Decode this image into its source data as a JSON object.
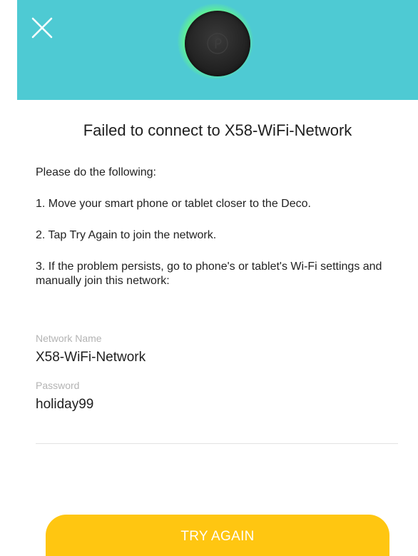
{
  "header": {
    "background_color": "#4ecad3",
    "close_icon": "close-icon",
    "device_icon": "deco-device-icon"
  },
  "title": "Failed to connect to X58-WiFi-Network",
  "instructions": {
    "intro": "Please do the following:",
    "steps": [
      "1. Move your smart phone or tablet closer to the Deco.",
      "2. Tap Try Again to join the network.",
      "3. If the problem persists, go to phone's or tablet's Wi-Fi settings and manually join this network:"
    ]
  },
  "network": {
    "name_label": "Network Name",
    "name_value": "X58-WiFi-Network",
    "password_label": "Password",
    "password_value": "holiday99"
  },
  "footer": {
    "button_label": "TRY AGAIN",
    "button_color": "#ffc611"
  }
}
